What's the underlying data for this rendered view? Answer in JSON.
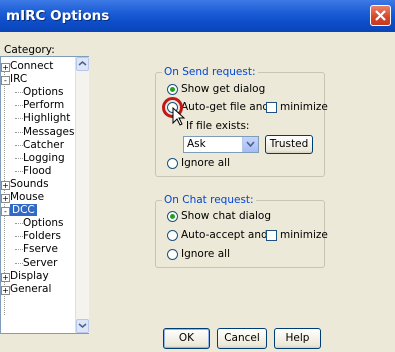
{
  "window": {
    "title": "mIRC Options"
  },
  "category": {
    "label": "Category:",
    "items": [
      {
        "label": "Connect",
        "level": 0,
        "expander": "+"
      },
      {
        "label": "IRC",
        "level": 0,
        "expander": "-"
      },
      {
        "label": "Options",
        "level": 1
      },
      {
        "label": "Perform",
        "level": 1
      },
      {
        "label": "Highlight",
        "level": 1
      },
      {
        "label": "Messages",
        "level": 1
      },
      {
        "label": "Catcher",
        "level": 1
      },
      {
        "label": "Logging",
        "level": 1
      },
      {
        "label": "Flood",
        "level": 1
      },
      {
        "label": "Sounds",
        "level": 0,
        "expander": "+"
      },
      {
        "label": "Mouse",
        "level": 0,
        "expander": "+"
      },
      {
        "label": "DCC",
        "level": 0,
        "expander": "-",
        "selected": true
      },
      {
        "label": "Options",
        "level": 1
      },
      {
        "label": "Folders",
        "level": 1
      },
      {
        "label": "Fserve",
        "level": 1
      },
      {
        "label": "Server",
        "level": 1
      },
      {
        "label": "Display",
        "level": 0,
        "expander": "+"
      },
      {
        "label": "General",
        "level": 0,
        "expander": "+"
      }
    ]
  },
  "send_request": {
    "title": "On Send request:",
    "show_get_dialog": "Show get dialog",
    "auto_get_pre": "Auto-get file and",
    "minimize": "minimize",
    "if_exists": "If file exists:",
    "combo_value": "Ask",
    "trusted": "Trusted",
    "ignore_all": "Ignore all"
  },
  "chat_request": {
    "title": "On Chat request:",
    "show_chat_dialog": "Show chat dialog",
    "auto_accept": "Auto-accept and",
    "minimize": "minimize",
    "ignore_all": "Ignore all"
  },
  "buttons": {
    "ok": "OK",
    "cancel": "Cancel",
    "help": "Help"
  },
  "colors": {
    "titlebar": "#0d4dc9",
    "selection": "#316ac5",
    "group_title": "#0046d5",
    "highlight_circle": "#c01717"
  }
}
